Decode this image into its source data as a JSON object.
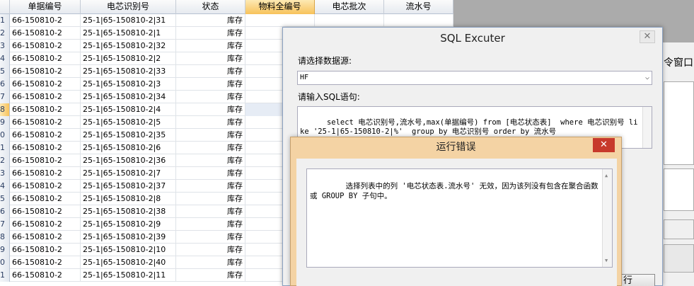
{
  "grid": {
    "columns": [
      "",
      "单据编号",
      "电芯识别号",
      "状态",
      "物料全编号",
      "电芯批次",
      "流水号"
    ],
    "active_column": 4,
    "selected_row_index": 7,
    "rows": [
      {
        "no": "1",
        "doc": "66-150810-2",
        "cell_id": "25-1|65-150810-2|31",
        "status": "库存"
      },
      {
        "no": "2",
        "doc": "66-150810-2",
        "cell_id": "25-1|65-150810-2|1",
        "status": "库存"
      },
      {
        "no": "3",
        "doc": "66-150810-2",
        "cell_id": "25-1|65-150810-2|32",
        "status": "库存"
      },
      {
        "no": "4",
        "doc": "66-150810-2",
        "cell_id": "25-1|65-150810-2|2",
        "status": "库存"
      },
      {
        "no": "5",
        "doc": "66-150810-2",
        "cell_id": "25-1|65-150810-2|33",
        "status": "库存"
      },
      {
        "no": "6",
        "doc": "66-150810-2",
        "cell_id": "25-1|65-150810-2|3",
        "status": "库存"
      },
      {
        "no": "7",
        "doc": "66-150810-2",
        "cell_id": "25-1|65-150810-2|34",
        "status": "库存"
      },
      {
        "no": "8",
        "doc": "66-150810-2",
        "cell_id": "25-1|65-150810-2|4",
        "status": "库存"
      },
      {
        "no": "9",
        "doc": "66-150810-2",
        "cell_id": "25-1|65-150810-2|5",
        "status": "库存"
      },
      {
        "no": "0",
        "doc": "66-150810-2",
        "cell_id": "25-1|65-150810-2|35",
        "status": "库存"
      },
      {
        "no": "1",
        "doc": "66-150810-2",
        "cell_id": "25-1|65-150810-2|6",
        "status": "库存"
      },
      {
        "no": "2",
        "doc": "66-150810-2",
        "cell_id": "25-1|65-150810-2|36",
        "status": "库存"
      },
      {
        "no": "3",
        "doc": "66-150810-2",
        "cell_id": "25-1|65-150810-2|7",
        "status": "库存"
      },
      {
        "no": "4",
        "doc": "66-150810-2",
        "cell_id": "25-1|65-150810-2|37",
        "status": "库存"
      },
      {
        "no": "5",
        "doc": "66-150810-2",
        "cell_id": "25-1|65-150810-2|8",
        "status": "库存"
      },
      {
        "no": "6",
        "doc": "66-150810-2",
        "cell_id": "25-1|65-150810-2|38",
        "status": "库存"
      },
      {
        "no": "7",
        "doc": "66-150810-2",
        "cell_id": "25-1|65-150810-2|9",
        "status": "库存"
      },
      {
        "no": "8",
        "doc": "66-150810-2",
        "cell_id": "25-1|65-150810-2|39",
        "status": "库存"
      },
      {
        "no": "9",
        "doc": "66-150810-2",
        "cell_id": "25-1|65-150810-2|10",
        "status": "库存"
      },
      {
        "no": "0",
        "doc": "66-150810-2",
        "cell_id": "25-1|65-150810-2|40",
        "status": "库存"
      },
      {
        "no": "1",
        "doc": "66-150810-2",
        "cell_id": "25-1|65-150810-2|11",
        "status": "库存"
      }
    ]
  },
  "background_window": {
    "partial_label": "令窗口"
  },
  "sql_window": {
    "title": "SQL Excuter",
    "close_glyph": "✕",
    "datasource_label": "请选择数据源:",
    "datasource_value": "HF",
    "sql_label": "请输入SQL语句:",
    "sql_text": "select 电芯识别号,流水号,max(单据编号) from [电芯状态表]  where 电芯识别号 like '25-1|65-150810-2|%'  group by 电芯识别号 order by 流水号",
    "run_button_partial": "行"
  },
  "error_dialog": {
    "title": "运行错误",
    "close_glyph": "✕",
    "message": "选择列表中的列 '电芯状态表.流水号' 无效，因为该列没有包含在聚合函数或 GROUP BY 子句中。"
  },
  "icons": {
    "dropdown": "chevron-down-icon",
    "scroll_up": "arrow-up-icon",
    "scroll_down": "arrow-down-icon"
  },
  "colors": {
    "error_title_bg": "#f4d3a4",
    "close_red": "#c7392b",
    "active_header": "#f7c25b"
  }
}
